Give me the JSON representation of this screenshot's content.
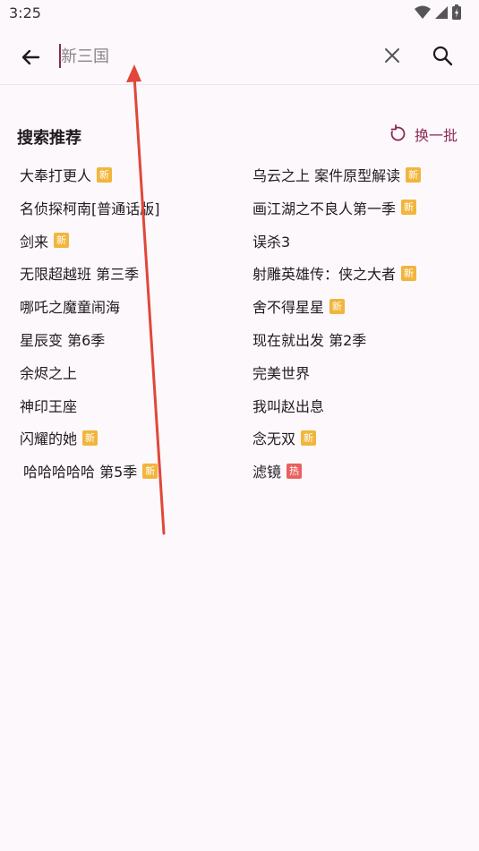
{
  "status_bar": {
    "time": "3:25"
  },
  "search": {
    "placeholder": "新三国",
    "value": ""
  },
  "section": {
    "title": "搜索推荐",
    "refresh_label": "换一批"
  },
  "recommendations": [
    {
      "title": "大奉打更人",
      "badge": "新",
      "badge_type": "new"
    },
    {
      "title": "乌云之上 案件原型解读",
      "badge": "新",
      "badge_type": "new"
    },
    {
      "title": "名侦探柯南[普通话版]",
      "badge": "",
      "badge_type": ""
    },
    {
      "title": "画江湖之不良人第一季",
      "badge": "新",
      "badge_type": "new"
    },
    {
      "title": "剑来",
      "badge": "新",
      "badge_type": "new"
    },
    {
      "title": "误杀3",
      "badge": "",
      "badge_type": ""
    },
    {
      "title": "无限超越班 第三季",
      "badge": "",
      "badge_type": ""
    },
    {
      "title": "射雕英雄传：侠之大者",
      "badge": "新",
      "badge_type": "new"
    },
    {
      "title": "哪吒之魔童闹海",
      "badge": "",
      "badge_type": ""
    },
    {
      "title": "舍不得星星",
      "badge": "新",
      "badge_type": "new"
    },
    {
      "title": "星辰变 第6季",
      "badge": "",
      "badge_type": ""
    },
    {
      "title": "现在就出发 第2季",
      "badge": "",
      "badge_type": ""
    },
    {
      "title": "余烬之上",
      "badge": "",
      "badge_type": ""
    },
    {
      "title": "完美世界",
      "badge": "",
      "badge_type": ""
    },
    {
      "title": "神印王座",
      "badge": "",
      "badge_type": ""
    },
    {
      "title": "我叫赵出息",
      "badge": "",
      "badge_type": ""
    },
    {
      "title": "闪耀的她",
      "badge": "新",
      "badge_type": "new"
    },
    {
      "title": "念无双",
      "badge": "新",
      "badge_type": "new"
    },
    {
      "title": "哈哈哈哈哈 第5季",
      "badge": "新",
      "badge_type": "new"
    },
    {
      "title": "滤镜",
      "badge": "热",
      "badge_type": "hot"
    }
  ],
  "colors": {
    "accent": "#8a2a55",
    "badge_new": "#f2b53c",
    "badge_hot": "#ea5f5f",
    "annotation": "#e0473a"
  },
  "icons": [
    "wifi-icon",
    "signal-icon",
    "battery-icon",
    "back-arrow-icon",
    "clear-icon",
    "search-icon",
    "refresh-icon"
  ]
}
